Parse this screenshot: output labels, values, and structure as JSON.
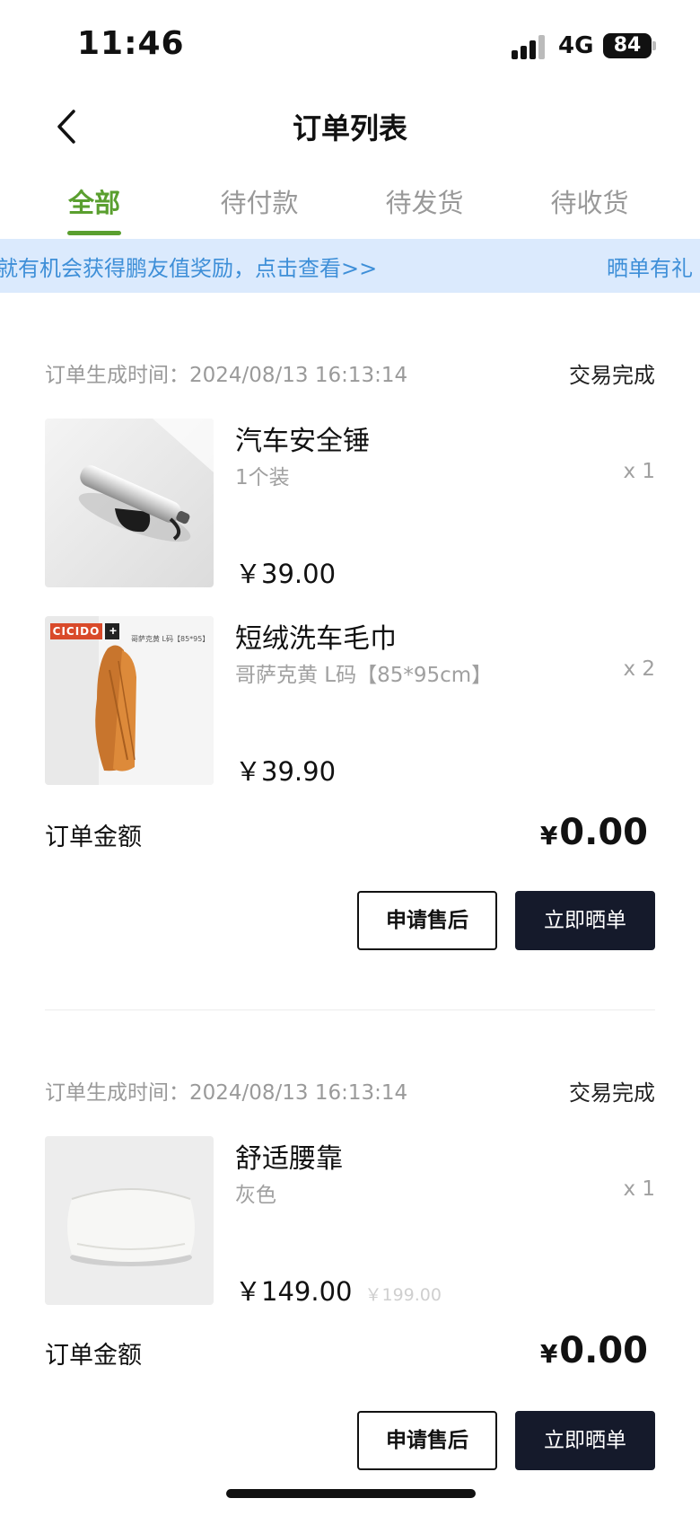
{
  "status_bar": {
    "time": "11:46",
    "network": "4G",
    "battery": "84"
  },
  "nav": {
    "title": "订单列表"
  },
  "tabs": [
    {
      "label": "全部",
      "active": true
    },
    {
      "label": "待付款",
      "active": false
    },
    {
      "label": "待发货",
      "active": false
    },
    {
      "label": "待收货",
      "active": false
    }
  ],
  "banner": {
    "text_main": "就有机会获得鹏友值奖励，点击查看>>",
    "text_next": "晒单有礼"
  },
  "orders": [
    {
      "time": "订单生成时间：2024/08/13 16:13:14",
      "status": "交易完成",
      "items": [
        {
          "name": "汽车安全锤",
          "spec": "1个装",
          "qty": "x 1",
          "price": "￥39.00",
          "thumb_icon": "safety-hammer-image"
        },
        {
          "name": "短绒洗车毛巾",
          "spec": "哥萨克黄 L码【85*95cm】",
          "qty": "x 2",
          "price": "￥39.90",
          "thumb_icon": "car-towel-image",
          "thumb_brand": "CICIDO",
          "thumb_caption": "哥萨克黄 L码【85*95】"
        }
      ],
      "amount_label": "订单金额",
      "amount_currency": "¥",
      "amount_value": "0.00",
      "btn_after_sale": "申请售后",
      "btn_review": "立即晒单"
    },
    {
      "time": "订单生成时间：2024/08/13 16:13:14",
      "status": "交易完成",
      "items": [
        {
          "name": "舒适腰靠",
          "spec": "灰色",
          "qty": "x 1",
          "price": "￥149.00",
          "orig_price": "￥199.00",
          "thumb_icon": "lumbar-pillow-image"
        }
      ],
      "amount_label": "订单金额",
      "amount_currency": "¥",
      "amount_value": "0.00",
      "btn_after_sale": "申请售后",
      "btn_review": "立即晒单"
    }
  ],
  "colors": {
    "accent_green": "#5a9f2f",
    "banner_bg": "#dbeafd",
    "banner_text": "#3e8fd8",
    "dark_button": "#151a2b"
  }
}
